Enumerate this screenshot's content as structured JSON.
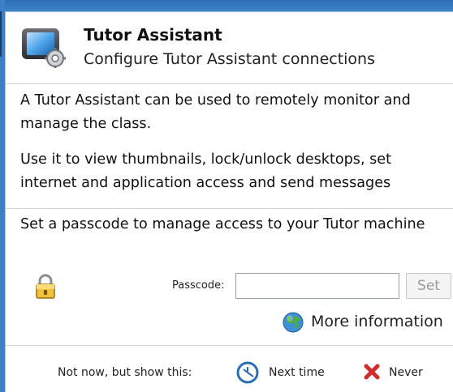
{
  "header": {
    "title": "Tutor Assistant",
    "subtitle": "Configure Tutor Assistant connections",
    "icon": "tutor-assistant-settings-icon"
  },
  "info": {
    "paragraph1": "A Tutor Assistant can be used to remotely monitor and manage the class.",
    "paragraph2": "Use it to view thumbnails, lock/unlock desktops, set internet and application access and send messages"
  },
  "passcode": {
    "description": "Set a passcode to manage access to your Tutor machine",
    "label": "Passcode:",
    "value": "",
    "set_label": "Set",
    "icon": "padlock-icon"
  },
  "more_info": {
    "label": "More information",
    "icon": "globe-icon"
  },
  "footer": {
    "prompt": "Not now, but show this:",
    "next_time_label": "Next time",
    "never_label": "Never"
  },
  "colors": {
    "frame": "#3b7fc6",
    "panel_border": "#a8c2dd",
    "disabled_text": "#9a9a9a",
    "never_red": "#d22b2b"
  }
}
